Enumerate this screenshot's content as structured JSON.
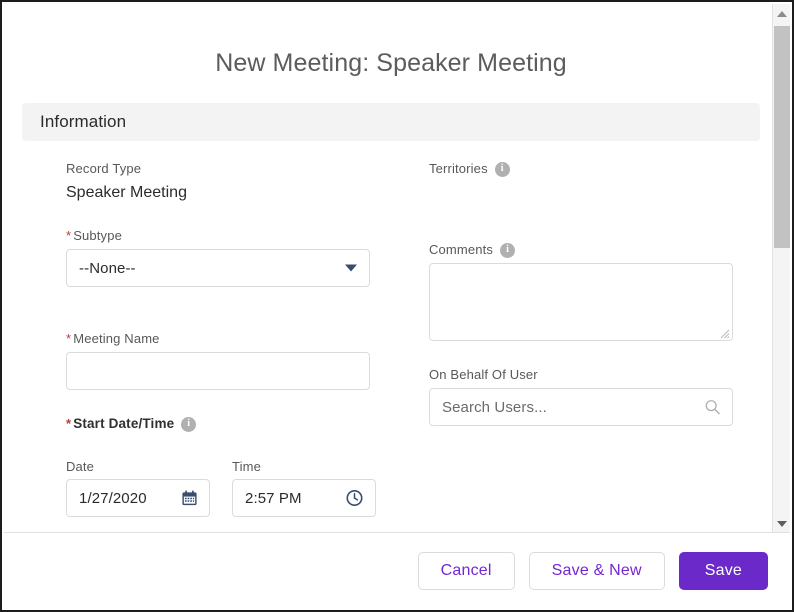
{
  "modal": {
    "title": "New Meeting: Speaker Meeting",
    "section_title": "Information"
  },
  "fields": {
    "record_type": {
      "label": "Record Type",
      "value": "Speaker Meeting"
    },
    "subtype": {
      "label": "Subtype",
      "required_marker": "*",
      "value": "--None--"
    },
    "meeting_name": {
      "label": "Meeting Name",
      "required_marker": "*",
      "value": ""
    },
    "start_date_time": {
      "label": "Start Date/Time",
      "required_marker": "*",
      "info_glyph": "i",
      "date_sublabel": "Date",
      "time_sublabel": "Time",
      "date_value": "1/27/2020",
      "time_value": "2:57 PM"
    },
    "territories": {
      "label": "Territories",
      "info_glyph": "i"
    },
    "comments": {
      "label": "Comments",
      "info_glyph": "i",
      "value": ""
    },
    "on_behalf_of_user": {
      "label": "On Behalf Of User",
      "placeholder": "Search Users...",
      "value": ""
    }
  },
  "footer": {
    "cancel_label": "Cancel",
    "save_new_label": "Save & New",
    "save_label": "Save"
  },
  "colors": {
    "brand_purple": "#6b29c9",
    "link_purple": "#7426d3",
    "required_red": "#c23934",
    "section_band": "#f3f3f3",
    "icon_navy": "#3a4d6e",
    "info_gray": "#b0b0b0"
  },
  "scrollbar": {
    "up_icon": "scroll-up-arrow-icon",
    "down_icon": "scroll-down-arrow-icon"
  }
}
